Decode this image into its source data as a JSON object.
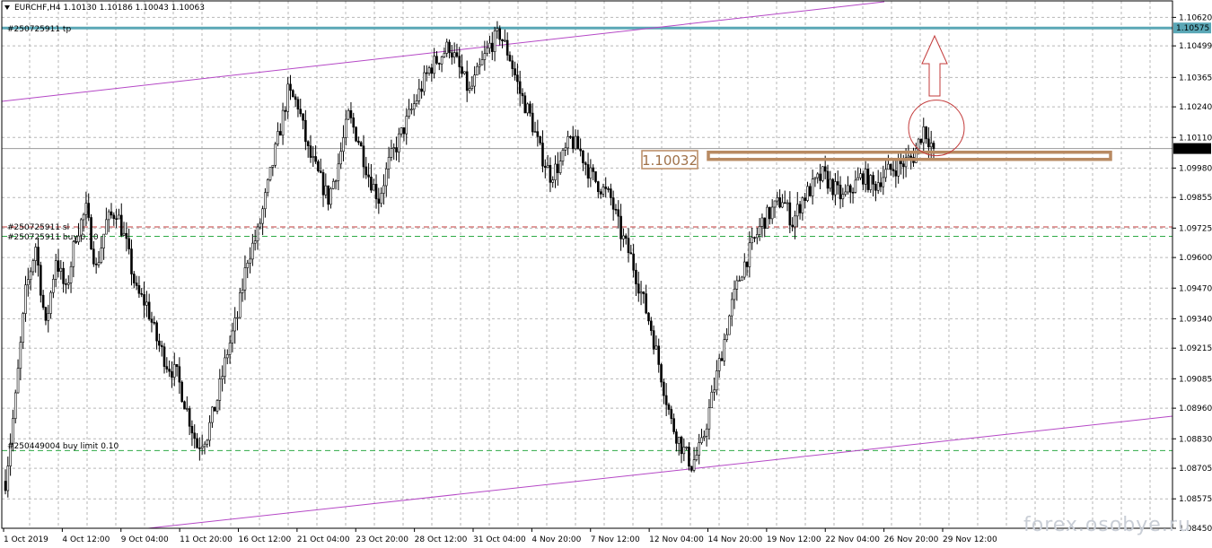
{
  "header": {
    "title": "EURCHF,H4  1.10130 1.10186 1.10043 1.10063"
  },
  "watermark": "forex.osobye.ru",
  "annotation": {
    "price_box": "1.10032"
  },
  "colors": {
    "grid": "#b7b7b7",
    "candle": "#000000",
    "tp_line": "#5aa7b6",
    "sl_line": "#c33b3b",
    "buy_line": "#2eaa46",
    "channel": "#b548c6",
    "zone": "#b88a62",
    "marker": "#c33b3b"
  },
  "order_labels": {
    "tp": "#250725911 tp",
    "sl": "#250725911 sl",
    "buy": "#250725911 buy 0.10",
    "buy_limit": "#250449004 buy limit 0.10"
  },
  "chart_data": {
    "type": "candlestick",
    "symbol": "EURCHF",
    "timeframe": "H4",
    "ohlc_current": {
      "open": 1.1013,
      "high": 1.10186,
      "low": 1.10043,
      "close": 1.10063
    },
    "y_ticks": [
      "1.10620",
      "1.10499",
      "1.10365",
      "1.10240",
      "1.10110",
      "1.09980",
      "1.09855",
      "1.09725",
      "1.09600",
      "1.09470",
      "1.09340",
      "1.09215",
      "1.09085",
      "1.08960",
      "1.08830",
      "1.08705",
      "1.08575",
      "1.08450"
    ],
    "x_ticks": [
      "1 Oct 2019",
      "4 Oct 12:00",
      "9 Oct 04:00",
      "11 Oct 20:00",
      "16 Oct 12:00",
      "21 Oct 04:00",
      "23 Oct 20:00",
      "28 Oct 12:00",
      "31 Oct 04:00",
      "4 Nov 20:00",
      "7 Nov 12:00",
      "12 Nov 04:00",
      "14 Nov 20:00",
      "19 Nov 12:00",
      "22 Nov 04:00",
      "26 Nov 20:00",
      "29 Nov 12:00"
    ],
    "ylim": [
      1.0845,
      1.1069
    ],
    "price_labels": {
      "tp": "1.10575",
      "current": "1.10063"
    },
    "levels": {
      "tp": 1.10575,
      "current": 1.10063,
      "sl": 1.0973,
      "buy": 1.0969,
      "buy_limit": 1.0878,
      "zone": 1.10032
    },
    "price_path": [
      [
        0,
        1.0865
      ],
      [
        4,
        1.09
      ],
      [
        8,
        1.0945
      ],
      [
        12,
        1.0965
      ],
      [
        16,
        1.093
      ],
      [
        20,
        1.096
      ],
      [
        24,
        1.0945
      ],
      [
        28,
        1.097
      ],
      [
        32,
        1.098
      ],
      [
        36,
        1.0955
      ],
      [
        40,
        1.0975
      ],
      [
        44,
        1.098
      ],
      [
        48,
        1.0965
      ],
      [
        52,
        1.0945
      ],
      [
        56,
        1.094
      ],
      [
        60,
        1.0925
      ],
      [
        64,
        1.0915
      ],
      [
        68,
        1.091
      ],
      [
        72,
        1.0895
      ],
      [
        76,
        1.088
      ],
      [
        80,
        1.0885
      ],
      [
        84,
        1.09
      ],
      [
        88,
        1.092
      ],
      [
        92,
        1.0935
      ],
      [
        96,
        1.096
      ],
      [
        100,
        1.097
      ],
      [
        104,
        1.099
      ],
      [
        108,
        1.101
      ],
      [
        112,
        1.103
      ],
      [
        116,
        1.1025
      ],
      [
        120,
        1.1005
      ],
      [
        124,
        1.0995
      ],
      [
        128,
        1.0985
      ],
      [
        132,
        1.1
      ],
      [
        136,
        1.102
      ],
      [
        140,
        1.101
      ],
      [
        144,
        1.0995
      ],
      [
        148,
        1.0985
      ],
      [
        152,
        1.1
      ],
      [
        156,
        1.101
      ],
      [
        160,
        1.102
      ],
      [
        164,
        1.103
      ],
      [
        168,
        1.104
      ],
      [
        172,
        1.1045
      ],
      [
        176,
        1.105
      ],
      [
        180,
        1.104
      ],
      [
        184,
        1.103
      ],
      [
        188,
        1.104
      ],
      [
        192,
        1.105
      ],
      [
        196,
        1.1055
      ],
      [
        200,
        1.1045
      ],
      [
        204,
        1.103
      ],
      [
        208,
        1.102
      ],
      [
        212,
        1.1005
      ],
      [
        216,
        1.0995
      ],
      [
        220,
        1.1
      ],
      [
        224,
        1.101
      ],
      [
        228,
        1.1005
      ],
      [
        232,
        1.0995
      ],
      [
        236,
        1.099
      ],
      [
        240,
        1.0985
      ],
      [
        244,
        1.097
      ],
      [
        248,
        1.096
      ],
      [
        252,
        1.0945
      ],
      [
        256,
        1.093
      ],
      [
        260,
        1.091
      ],
      [
        264,
        1.089
      ],
      [
        268,
        1.088
      ],
      [
        272,
        1.0872
      ],
      [
        276,
        1.088
      ],
      [
        280,
        1.09
      ],
      [
        284,
        1.092
      ],
      [
        288,
        1.094
      ],
      [
        292,
        1.0955
      ],
      [
        296,
        1.0965
      ],
      [
        300,
        1.0975
      ],
      [
        304,
        1.098
      ],
      [
        308,
        1.0985
      ],
      [
        312,
        1.0975
      ],
      [
        316,
        1.0985
      ],
      [
        320,
        1.099
      ],
      [
        324,
        1.0995
      ],
      [
        328,
        1.099
      ],
      [
        332,
        1.0985
      ],
      [
        336,
        1.099
      ],
      [
        340,
        1.0995
      ],
      [
        344,
        1.099
      ],
      [
        348,
        1.0995
      ],
      [
        352,
        1.0998
      ],
      [
        356,
        1.1
      ],
      [
        360,
        1.1003
      ],
      [
        364,
        1.1015
      ],
      [
        368,
        1.1006
      ]
    ]
  }
}
